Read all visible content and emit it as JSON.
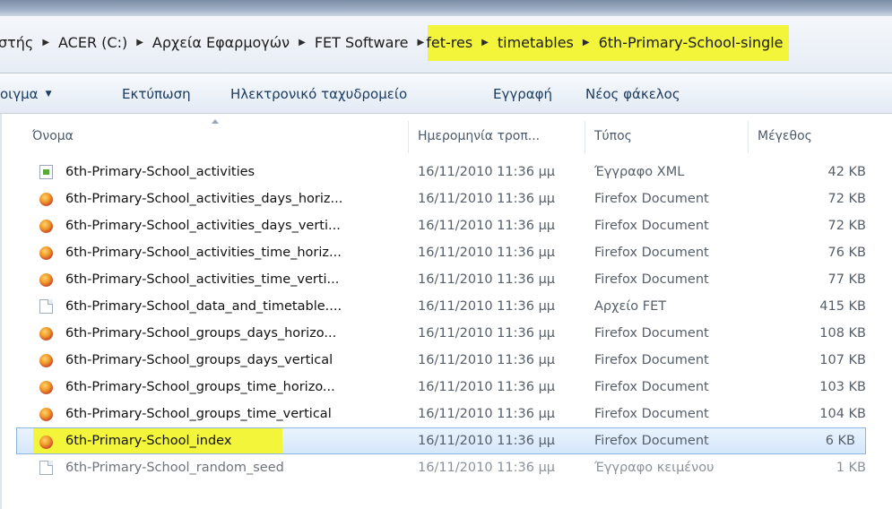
{
  "breadcrumbs": [
    {
      "label": "στής",
      "highlighted": false
    },
    {
      "label": "ACER (C:)",
      "highlighted": false
    },
    {
      "label": "Αρχεία Εφαρμογών",
      "highlighted": false
    },
    {
      "label": "FET Software",
      "highlighted": false
    },
    {
      "label": "fet-res",
      "highlighted": true
    },
    {
      "label": "timetables",
      "highlighted": true
    },
    {
      "label": "6th-Primary-School-single",
      "highlighted": true
    }
  ],
  "toolbar": {
    "organize_label": "οιγμα",
    "print_label": "Εκτύπωση",
    "email_label": "Ηλεκτρονικό ταχυδρομείο",
    "burn_label": "Εγγραφή",
    "newfolder_label": "Νέος φάκελος"
  },
  "columns": {
    "name": "Όνομα",
    "date": "Ημερομηνία τροπ...",
    "type": "Τύπος",
    "size": "Μέγεθος"
  },
  "files": [
    {
      "icon": "xml-file-icon",
      "name": "6th-Primary-School_activities",
      "date": "16/11/2010 11:36 μμ",
      "type": "Έγγραφο XML",
      "size": "42 KB"
    },
    {
      "icon": "firefox-document-icon",
      "name": "6th-Primary-School_activities_days_horiz...",
      "date": "16/11/2010 11:36 μμ",
      "type": "Firefox Document",
      "size": "72 KB"
    },
    {
      "icon": "firefox-document-icon",
      "name": "6th-Primary-School_activities_days_verti...",
      "date": "16/11/2010 11:36 μμ",
      "type": "Firefox Document",
      "size": "72 KB"
    },
    {
      "icon": "firefox-document-icon",
      "name": "6th-Primary-School_activities_time_horiz...",
      "date": "16/11/2010 11:36 μμ",
      "type": "Firefox Document",
      "size": "76 KB"
    },
    {
      "icon": "firefox-document-icon",
      "name": "6th-Primary-School_activities_time_verti...",
      "date": "16/11/2010 11:36 μμ",
      "type": "Firefox Document",
      "size": "77 KB"
    },
    {
      "icon": "blank-file-icon",
      "name": "6th-Primary-School_data_and_timetable....",
      "date": "16/11/2010 11:36 μμ",
      "type": "Αρχείο FET",
      "size": "415 KB"
    },
    {
      "icon": "firefox-document-icon",
      "name": "6th-Primary-School_groups_days_horizo...",
      "date": "16/11/2010 11:36 μμ",
      "type": "Firefox Document",
      "size": "108 KB"
    },
    {
      "icon": "firefox-document-icon",
      "name": "6th-Primary-School_groups_days_vertical",
      "date": "16/11/2010 11:36 μμ",
      "type": "Firefox Document",
      "size": "107 KB"
    },
    {
      "icon": "firefox-document-icon",
      "name": "6th-Primary-School_groups_time_horizo...",
      "date": "16/11/2010 11:36 μμ",
      "type": "Firefox Document",
      "size": "103 KB"
    },
    {
      "icon": "firefox-document-icon",
      "name": "6th-Primary-School_groups_time_vertical",
      "date": "16/11/2010 11:36 μμ",
      "type": "Firefox Document",
      "size": "104 KB"
    },
    {
      "icon": "firefox-document-icon",
      "name": "6th-Primary-School_index",
      "date": "16/11/2010 11:36 μμ",
      "type": "Firefox Document",
      "size": "6 KB",
      "selected": true
    },
    {
      "icon": "blank-file-icon",
      "name": "6th-Primary-School_random_seed",
      "date": "16/11/2010 11:36 μμ",
      "type": "Έγγραφο κειμένου",
      "size": "1 KB",
      "partial": true
    }
  ],
  "colors": {
    "highlight": "#f2f53a",
    "selection": "#d5e7fb",
    "toolbar_text": "#1a3a5e"
  }
}
